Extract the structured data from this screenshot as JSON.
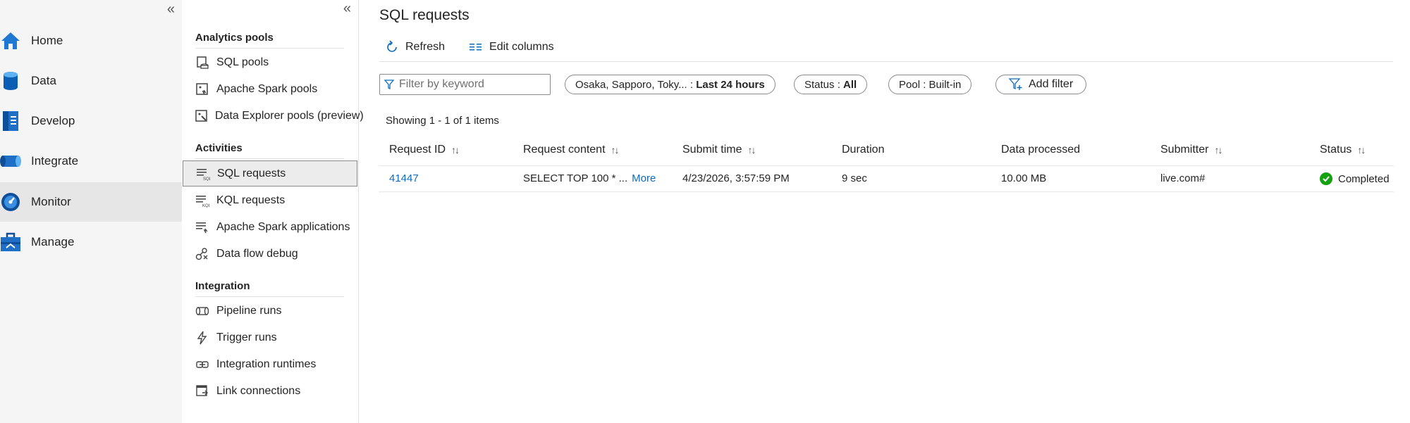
{
  "left_nav": {
    "collapse_glyph": "«",
    "items": [
      {
        "label": "Home",
        "icon": "home-icon"
      },
      {
        "label": "Data",
        "icon": "database-icon"
      },
      {
        "label": "Develop",
        "icon": "document-icon"
      },
      {
        "label": "Integrate",
        "icon": "pipeline-icon"
      },
      {
        "label": "Monitor",
        "icon": "gauge-icon",
        "active": true
      },
      {
        "label": "Manage",
        "icon": "toolbox-icon"
      }
    ]
  },
  "sub_nav": {
    "collapse_glyph": "«",
    "sections": [
      {
        "title": "Analytics pools",
        "items": [
          "SQL pools",
          "Apache Spark pools",
          "Data Explorer pools (preview)"
        ]
      },
      {
        "title": "Activities",
        "items": [
          "SQL requests",
          "KQL requests",
          "Apache Spark applications",
          "Data flow debug"
        ]
      },
      {
        "title": "Integration",
        "items": [
          "Pipeline runs",
          "Trigger runs",
          "Integration runtimes",
          "Link connections"
        ]
      }
    ],
    "active_item": "SQL requests"
  },
  "main": {
    "title": "SQL requests",
    "toolbar": {
      "refresh_label": "Refresh",
      "edit_columns_label": "Edit columns"
    },
    "filter": {
      "placeholder": "Filter by keyword"
    },
    "pills": {
      "time_prefix": "Osaka, Sapporo, Toky... : ",
      "time_value": "Last 24 hours",
      "status_prefix": "Status : ",
      "status_value": "All",
      "pool_prefix": "Pool : ",
      "pool_value": "Built-in",
      "add_filter_label": "Add filter"
    },
    "showing_text": "Showing 1 - 1 of 1 items",
    "table": {
      "columns": [
        "Request ID",
        "Request content",
        "Submit time",
        "Duration",
        "Data processed",
        "Submitter",
        "Status"
      ],
      "sort_glyph": "↑↓",
      "rows": [
        {
          "request_id": "41447",
          "request_content": "SELECT TOP 100 * ...",
          "more_label": "More",
          "submit_time": "4/23/2026, 3:57:59 PM",
          "duration": "9 sec",
          "data_processed": "10.00 MB",
          "submitter": "live.com#",
          "status": "Completed"
        }
      ]
    }
  },
  "colors": {
    "link": "#0f6cbd",
    "success": "#13a10e",
    "nav_blue": "#0078d4"
  }
}
